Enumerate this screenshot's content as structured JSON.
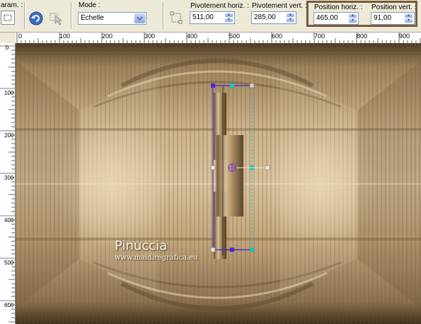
{
  "toolbar": {
    "params_label": "aram. :",
    "mode_label": "Mode :",
    "mode_value": "Échelle",
    "pivot_h_label": "Pivotement horiz. :",
    "pivot_h_value": "511,00",
    "pivot_v_label": "Pivotement vert. :",
    "pivot_v_value": "285,00",
    "pos_h_label": "Position horiz. :",
    "pos_h_value": "465,00",
    "pos_v_label": "Position vert. :",
    "pos_v_value": "91,00"
  },
  "ruler_h": {
    "ticks": [
      "0",
      "100",
      "200",
      "300",
      "400",
      "500",
      "600",
      "700",
      "800",
      "900"
    ]
  },
  "ruler_v": {
    "ticks": [
      "0",
      "100",
      "200",
      "300",
      "400",
      "500",
      "600"
    ]
  },
  "watermark": {
    "name": "Pinuccia",
    "url": "www.maidiregrafica.eu"
  },
  "colors": {
    "accent_frame": "#7a5a39",
    "handle_purple": "#4b2bd0",
    "handle_teal": "#1fbfb8"
  }
}
